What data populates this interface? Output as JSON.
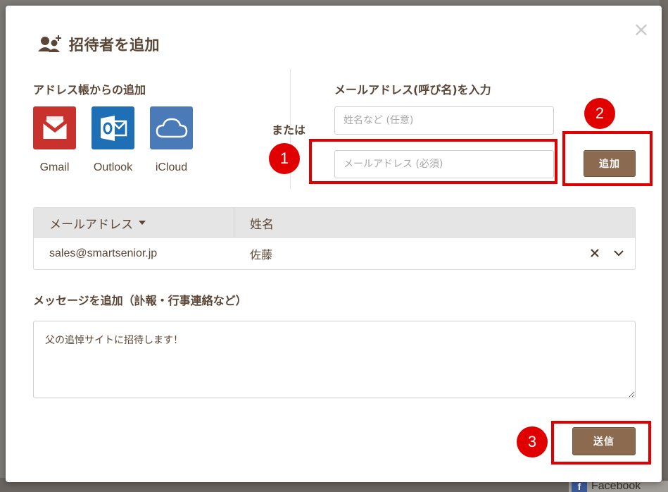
{
  "background": {
    "footer_link": "Facebook"
  },
  "dialog": {
    "title": "招待者を追加",
    "close_symbol": "×"
  },
  "address_book": {
    "heading": "アドレス帳からの追加",
    "providers": [
      {
        "label": "Gmail",
        "icon": "gmail-icon",
        "color": "#c8312c"
      },
      {
        "label": "Outlook",
        "icon": "outlook-icon",
        "color": "#1f6fb6"
      },
      {
        "label": "iCloud",
        "icon": "icloud-icon",
        "color": "#4a7ab7"
      }
    ]
  },
  "divider_text": "または",
  "manual_entry": {
    "heading": "メールアドレス(呼び名)を入力",
    "name_placeholder": "姓名など (任意)",
    "email_placeholder": "メールアドレス (必須)",
    "add_label": "追加"
  },
  "recipients_table": {
    "columns": [
      "メールアドレス",
      "姓名"
    ],
    "rows": [
      {
        "email": "sales@smartsenior.jp",
        "name": "佐藤"
      }
    ]
  },
  "message": {
    "heading": "メッセージを追加（訃報・行事連絡など）",
    "value": "父の追悼サイトに招待します！"
  },
  "send_label": "送信",
  "callouts": [
    "1",
    "2",
    "3"
  ],
  "colors": {
    "accent_brown": "#8b6a4f",
    "text_brown": "#5b4636",
    "callout_red": "#e00000"
  }
}
